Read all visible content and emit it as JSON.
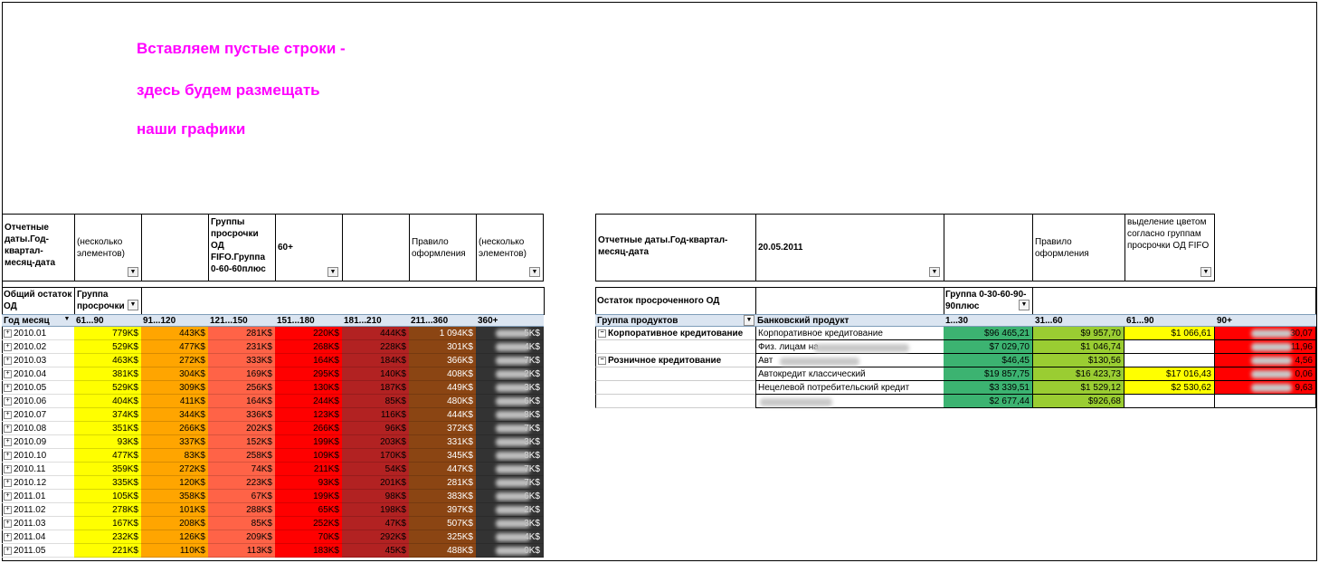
{
  "notes": [
    "Вставляем пустые строки -",
    "здесь будем размещать",
    "наши графики"
  ],
  "left": {
    "filter_row": {
      "date_label": "Отчетные даты.Год-квартал-месяц-дата",
      "date_value": "(несколько элементов)",
      "group_label": "Группы просрочки ОД FIFO.Группа 0-60-60плюс",
      "group_value": "60+",
      "rule_label": "Правило оформления",
      "rule_value": "(несколько элементов)"
    },
    "measure_label": "Общий остаток ОД",
    "column_field": "Группа просрочки",
    "row_field": "Год месяц",
    "columns": [
      "61...90",
      "91...120",
      "121...150",
      "151...180",
      "181...210",
      "211...360",
      "360+"
    ],
    "column_colors": [
      "#ffff00",
      "#ffa500",
      "#ff6347",
      "#ff0000",
      "#b22222",
      "#8b4513",
      "#333333"
    ],
    "rows": [
      {
        "label": "2010.01",
        "values": [
          "779K$",
          "443K$",
          "281K$",
          "220K$",
          "444K$",
          "1 094K$",
          "5K$"
        ]
      },
      {
        "label": "2010.02",
        "values": [
          "529K$",
          "477K$",
          "231K$",
          "268K$",
          "228K$",
          "301K$",
          "4K$"
        ]
      },
      {
        "label": "2010.03",
        "values": [
          "463K$",
          "272K$",
          "333K$",
          "164K$",
          "184K$",
          "366K$",
          "7K$"
        ]
      },
      {
        "label": "2010.04",
        "values": [
          "381K$",
          "304K$",
          "169K$",
          "295K$",
          "140K$",
          "408K$",
          "2K$"
        ]
      },
      {
        "label": "2010.05",
        "values": [
          "529K$",
          "309K$",
          "256K$",
          "130K$",
          "187K$",
          "449K$",
          "3K$"
        ]
      },
      {
        "label": "2010.06",
        "values": [
          "404K$",
          "411K$",
          "164K$",
          "244K$",
          "85K$",
          "480K$",
          "6K$"
        ]
      },
      {
        "label": "2010.07",
        "values": [
          "374K$",
          "344K$",
          "336K$",
          "123K$",
          "116K$",
          "444K$",
          "8K$"
        ]
      },
      {
        "label": "2010.08",
        "values": [
          "351K$",
          "266K$",
          "202K$",
          "266K$",
          "96K$",
          "372K$",
          "7K$"
        ]
      },
      {
        "label": "2010.09",
        "values": [
          "93K$",
          "337K$",
          "152K$",
          "199K$",
          "203K$",
          "331K$",
          "3K$"
        ]
      },
      {
        "label": "2010.10",
        "values": [
          "477K$",
          "83K$",
          "258K$",
          "109K$",
          "170K$",
          "345K$",
          "8K$"
        ]
      },
      {
        "label": "2010.11",
        "values": [
          "359K$",
          "272K$",
          "74K$",
          "211K$",
          "54K$",
          "447K$",
          "7K$"
        ]
      },
      {
        "label": "2010.12",
        "values": [
          "335K$",
          "120K$",
          "223K$",
          "93K$",
          "201K$",
          "281K$",
          "7K$"
        ]
      },
      {
        "label": "2011.01",
        "values": [
          "105K$",
          "358K$",
          "67K$",
          "199K$",
          "98K$",
          "383K$",
          "6K$"
        ]
      },
      {
        "label": "2011.02",
        "values": [
          "278K$",
          "101K$",
          "288K$",
          "65K$",
          "198K$",
          "397K$",
          "2K$"
        ]
      },
      {
        "label": "2011.03",
        "values": [
          "167K$",
          "208K$",
          "85K$",
          "252K$",
          "47K$",
          "507K$",
          "3K$"
        ]
      },
      {
        "label": "2011.04",
        "values": [
          "232K$",
          "126K$",
          "209K$",
          "70K$",
          "292K$",
          "325K$",
          "4K$"
        ]
      },
      {
        "label": "2011.05",
        "values": [
          "221K$",
          "110K$",
          "113K$",
          "183K$",
          "45K$",
          "488K$",
          "0K$"
        ]
      }
    ]
  },
  "right": {
    "filter_row": {
      "date_label": "Отчетные даты.Год-квартал-месяц-дата",
      "date_value": "20.05.2011",
      "rule_label": "Правило оформления",
      "rule_value": "выделение цветом согласно группам просрочки ОД FIFO"
    },
    "measure_label": "Остаток просроченного ОД",
    "column_field": "Группа 0-30-60-90-90плюс",
    "row_field_1": "Группа продуктов",
    "row_field_2": "Банковский продукт",
    "columns": [
      "1...30",
      "31...60",
      "61...90",
      "90+"
    ],
    "column_colors": [
      "#3cb371",
      "#9acd32",
      "#ffff00",
      "#ff0000"
    ],
    "rows": [
      {
        "group": "Корпоративное кредитование",
        "product": "Корпоративное кредитование",
        "values": [
          "$96 465,21",
          "$9 957,70",
          "$1 066,61",
          "30,07"
        ]
      },
      {
        "group": "",
        "product": "Физ. лицам на",
        "values": [
          "$7 029,70",
          "$1 046,74",
          "",
          "11,96"
        ]
      },
      {
        "group": "Розничное кредитование",
        "product": "Авт",
        "values": [
          "$46,45",
          "$130,56",
          "",
          "4,56"
        ]
      },
      {
        "group": "",
        "product": "Автокредит классический",
        "values": [
          "$19 857,75",
          "$16 423,73",
          "$17 016,43",
          "0,06"
        ]
      },
      {
        "group": "",
        "product": "Нецелевой потребительский кредит",
        "values": [
          "$3 339,51",
          "$1 529,12",
          "$2 530,62",
          "9,63"
        ]
      },
      {
        "group": "",
        "product": "",
        "values": [
          "$2 677,44",
          "$926,68",
          "",
          ""
        ]
      }
    ]
  }
}
